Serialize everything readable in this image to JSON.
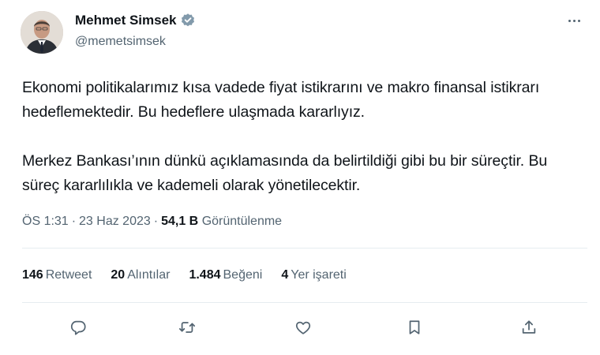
{
  "author": {
    "display_name": "Mehmet Simsek",
    "handle": "@memetsimsek",
    "verified": true
  },
  "tweet": {
    "paragraphs": [
      "Ekonomi politikalarımız kısa vadede fiyat istikrarını ve makro finansal istikrarı hedeflemektedir. Bu hedeflere ulaşmada kararlıyız.",
      "Merkez Bankası’ının dünkü açıklamasında da belirtildiği gibi bu bir süreçtir. Bu süreç kararlılıkla ve kademeli olarak yönetilecektir."
    ]
  },
  "meta": {
    "time": "ÖS 1:31",
    "separator": "·",
    "date": "23 Haz 2023",
    "views_count": "54,1 B",
    "views_label": "Görüntülenme"
  },
  "stats": [
    {
      "count": "146",
      "label": "Retweet"
    },
    {
      "count": "20",
      "label": "Alıntılar"
    },
    {
      "count": "1.484",
      "label": "Beğeni"
    },
    {
      "count": "4",
      "label": "Yer işareti"
    }
  ],
  "actions": [
    "reply-icon",
    "retweet-icon",
    "like-icon",
    "bookmark-icon",
    "share-icon"
  ],
  "colors": {
    "text": "#0f1419",
    "secondary": "#536471",
    "divider": "#e6ecf0",
    "verified": "#829aab"
  }
}
